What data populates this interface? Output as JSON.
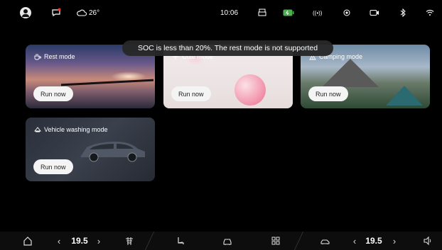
{
  "status_bar": {
    "weather_temp": "26°",
    "time": "10:06",
    "signal_label": "((•))"
  },
  "toast": {
    "message": "SOC is less than 20%. The rest mode is not supported"
  },
  "cards": [
    {
      "id": "rest",
      "title": "Rest mode",
      "button_label": "Run now"
    },
    {
      "id": "cute",
      "title": "Cute mode",
      "button_label": "Run now"
    },
    {
      "id": "camping",
      "title": "Camping mode",
      "button_label": "Run now"
    },
    {
      "id": "washing",
      "title": "Vehicle washing mode",
      "button_label": "Run now"
    }
  ],
  "bottom_bar": {
    "left_temp": "19.5",
    "right_temp": "19.5"
  },
  "colors": {
    "background": "#000000",
    "battery": "#4caf50",
    "button_bg": "#f4f4f4"
  }
}
